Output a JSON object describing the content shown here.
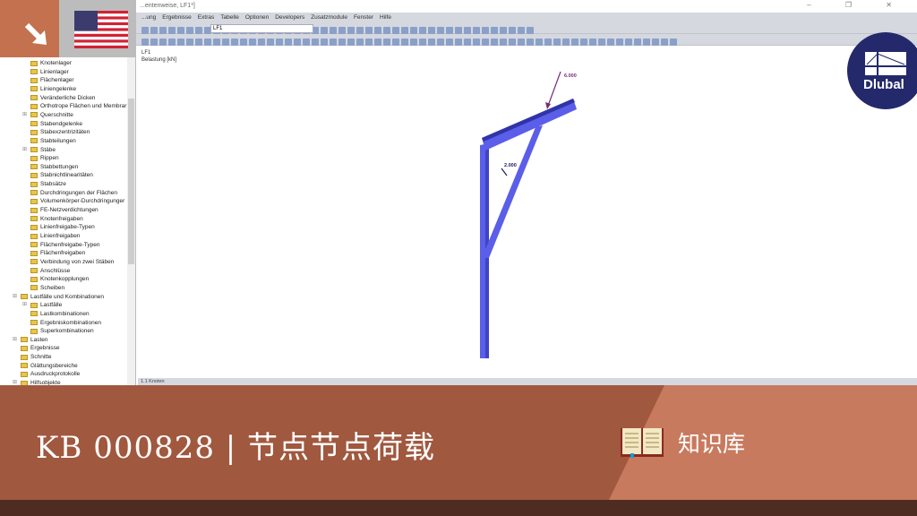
{
  "window": {
    "title": "...entenweise, LF1*]",
    "controls": "– ❐ ✕"
  },
  "menu": [
    "...ung",
    "Ergebnisse",
    "Extras",
    "Tabelle",
    "Optionen",
    "Developers",
    "Zusatzmodule",
    "Fenster",
    "Hilfe"
  ],
  "toolbar": {
    "load_case": "LF1"
  },
  "view": {
    "line1": "LF1",
    "line2": "Belastung [kN]",
    "load_top": "6.000",
    "load_side": "2.000"
  },
  "status": {
    "panel": "1.1 Knoten"
  },
  "tree": [
    {
      "label": "Knotenlager",
      "level": 3
    },
    {
      "label": "Linienlager",
      "level": 3
    },
    {
      "label": "Flächenlager",
      "level": 3
    },
    {
      "label": "Liniengelenke",
      "level": 3
    },
    {
      "label": "Veränderliche Dicken",
      "level": 3
    },
    {
      "label": "Orthotrope Flächen und Membrar",
      "level": 3
    },
    {
      "label": "Querschnitte",
      "level": 3,
      "exp": true
    },
    {
      "label": "Stabendgelenke",
      "level": 3
    },
    {
      "label": "Stabexzentrizitäten",
      "level": 3
    },
    {
      "label": "Stabteilungen",
      "level": 3
    },
    {
      "label": "Stäbe",
      "level": 3,
      "exp": true
    },
    {
      "label": "Rippen",
      "level": 3
    },
    {
      "label": "Stabbettungen",
      "level": 3
    },
    {
      "label": "Stabnichtlinearitäten",
      "level": 3
    },
    {
      "label": "Stabsätze",
      "level": 3
    },
    {
      "label": "Durchdringungen der Flächen",
      "level": 3
    },
    {
      "label": "Volumenkörper-Durchdringunger",
      "level": 3
    },
    {
      "label": "FE-Netzverdichtungen",
      "level": 3
    },
    {
      "label": "Knotenfreigaben",
      "level": 3
    },
    {
      "label": "Linienfreigabe-Typen",
      "level": 3
    },
    {
      "label": "Linienfreigaben",
      "level": 3
    },
    {
      "label": "Flächenfreigabe-Typen",
      "level": 3
    },
    {
      "label": "Flächenfreigaben",
      "level": 3
    },
    {
      "label": "Verbindung von zwei Stäben",
      "level": 3
    },
    {
      "label": "Anschlüsse",
      "level": 3
    },
    {
      "label": "Knotenkopplungen",
      "level": 3
    },
    {
      "label": "Scheiben",
      "level": 3
    },
    {
      "label": "Lastfälle und Kombinationen",
      "level": 2,
      "exp": true
    },
    {
      "label": "Lastfälle",
      "level": 3,
      "exp": true
    },
    {
      "label": "Lastkombinationen",
      "level": 3
    },
    {
      "label": "Ergebniskombinationen",
      "level": 3
    },
    {
      "label": "Superkombinationen",
      "level": 3
    },
    {
      "label": "Lasten",
      "level": 2,
      "exp": true
    },
    {
      "label": "Ergebnisse",
      "level": 2
    },
    {
      "label": "Schnitte",
      "level": 2
    },
    {
      "label": "Glättungsbereiche",
      "level": 2
    },
    {
      "label": "Ausdruckprotokolle",
      "level": 2
    },
    {
      "label": "Hilfsobjekte",
      "level": 2,
      "exp": true
    }
  ],
  "banner": {
    "title": "KB 000828 | 节点节点荷载",
    "category": "知识库"
  },
  "logo": {
    "text": "Dlubal"
  },
  "colors": {
    "banner_dark": "#a0583f",
    "banner_light": "#c87a5e",
    "logo": "#23296b",
    "member": "#5a5ee8"
  }
}
